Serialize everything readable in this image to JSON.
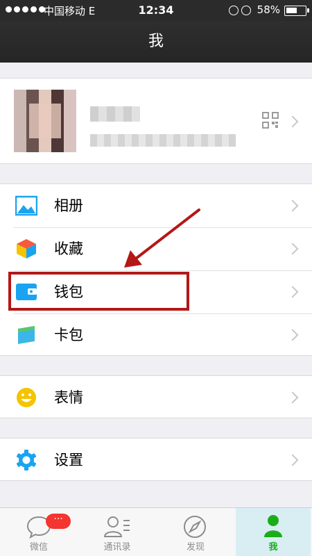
{
  "status": {
    "carrier": "中国移动  E",
    "time": "12:34",
    "battery": "58%"
  },
  "nav": {
    "title": "我"
  },
  "profile": {
    "qr_icon": "qr-code-icon"
  },
  "menu": {
    "group1": [
      {
        "label": "相册",
        "icon": "photo-album-icon",
        "color": "#1aa3f0"
      },
      {
        "label": "收藏",
        "icon": "favorites-cube-icon",
        "color": "#f45a3c"
      },
      {
        "label": "钱包",
        "icon": "wallet-icon",
        "color": "#1aa3f0"
      },
      {
        "label": "卡包",
        "icon": "card-pack-icon",
        "color": "#3bb6e6"
      }
    ],
    "group2": [
      {
        "label": "表情",
        "icon": "smiley-icon",
        "color": "#f5c300"
      }
    ],
    "group3": [
      {
        "label": "设置",
        "icon": "gear-icon",
        "color": "#1aa3f0"
      }
    ]
  },
  "tabs": [
    {
      "label": "微信",
      "icon": "chat-bubble-icon",
      "badge": "···"
    },
    {
      "label": "通讯录",
      "icon": "contacts-icon"
    },
    {
      "label": "发现",
      "icon": "compass-icon"
    },
    {
      "label": "我",
      "icon": "person-icon",
      "active": true
    }
  ],
  "colors": {
    "annotation": "#b41717",
    "accent": "#1aad19",
    "badge": "#f43530"
  }
}
